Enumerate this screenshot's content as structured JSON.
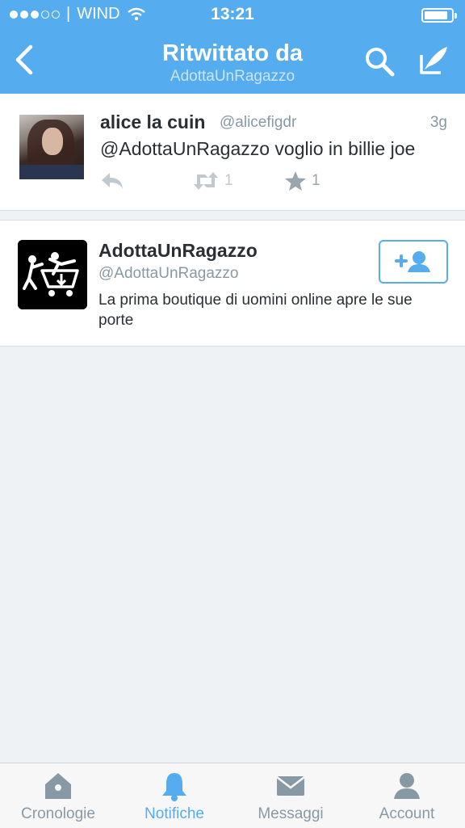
{
  "status_bar": {
    "carrier": "WIND",
    "time": "13:21",
    "signal_filled": 3,
    "signal_total": 5,
    "battery_level": 0.85
  },
  "nav": {
    "title": "Ritwittato da",
    "subtitle": "AdottaUnRagazzo",
    "icons": [
      "back-chevron-icon",
      "search-icon",
      "compose-tweet-icon"
    ]
  },
  "tweet": {
    "name": "alice la cuin",
    "handle": "@alicefigdr",
    "time": "3g",
    "text": "@AdottaUnRagazzo voglio in billie joe",
    "retweet_count": "1",
    "favorite_count": "1"
  },
  "user": {
    "name": "AdottaUnRagazzo",
    "handle": "@AdottaUnRagazzo",
    "bio": "La prima boutique di uomini online apre le sue porte",
    "follow_icon": "add-user-icon"
  },
  "tabs": [
    {
      "label": "Cronologie",
      "icon": "home-icon",
      "active": false
    },
    {
      "label": "Notifiche",
      "icon": "bell-icon",
      "active": true
    },
    {
      "label": "Messaggi",
      "icon": "envelope-icon",
      "active": false
    },
    {
      "label": "Account",
      "icon": "person-icon",
      "active": false
    }
  ],
  "colors": {
    "brand_blue": "#55acee",
    "text_dark": "#292f33",
    "text_muted": "#8899a6",
    "background": "#eef2f5"
  }
}
